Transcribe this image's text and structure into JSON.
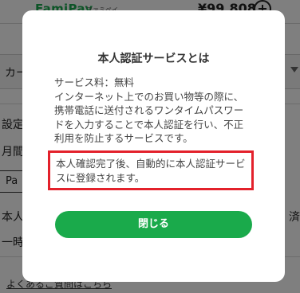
{
  "background": {
    "brand": "FamiPay",
    "brand_sub": "ファミペイ",
    "balance": "¥99,808",
    "payment_bar_label": "カー",
    "setting_label": "設定",
    "month_label": "月間",
    "pay_chip_label": "Pa",
    "identity_label": "本人",
    "status_suffix": "済",
    "temp_label": "一時",
    "faq_link": "よくあるご質問はこちら"
  },
  "modal": {
    "title": "本人認証サービスとは",
    "body_lines": [
      "サービス料：無料",
      "インターネット上でのお買い物等の際に、",
      "携帯電話に送付されるワンタイムパスワー",
      "ドを入力することで本人認証を行い、不正",
      "利用を防止するサービスです。"
    ],
    "notice_lines": [
      "本人確認完了後、自動的に本人認証サービ",
      "スに登録されます。"
    ],
    "close_label": "閉じる"
  },
  "colors": {
    "accent_green": "#1aaa4b",
    "highlight_red": "#e3212b"
  }
}
